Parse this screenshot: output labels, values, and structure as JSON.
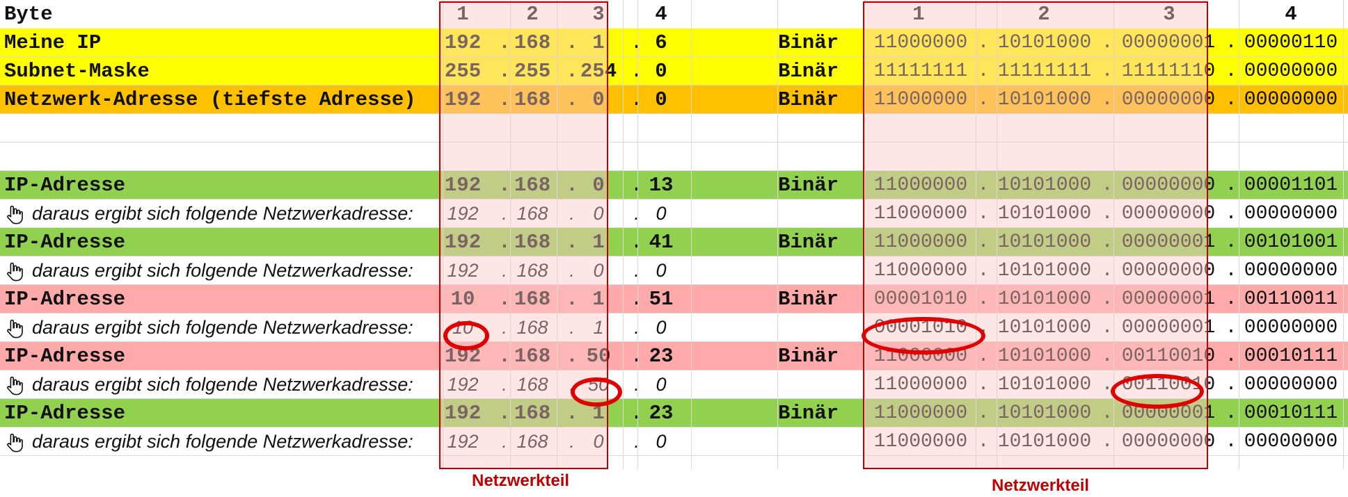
{
  "header": {
    "label": "Byte",
    "dec_cols": [
      "1",
      "2",
      "3",
      "4"
    ],
    "bin_cols": [
      "1",
      "2",
      "3",
      "4"
    ]
  },
  "rows": [
    {
      "label": "Meine IP",
      "style": "yellow",
      "kind": "main",
      "dec": [
        "192",
        "168",
        "1",
        "6"
      ],
      "bin_label": "Binär",
      "bin": [
        "11000000",
        "10101000",
        "00000001",
        "00000110"
      ]
    },
    {
      "label": "Subnet-Maske",
      "style": "yellow",
      "kind": "main",
      "dec": [
        "255",
        "255",
        "254",
        "0"
      ],
      "bin_label": "Binär",
      "bin": [
        "11111111",
        "11111111",
        "11111110",
        "00000000"
      ]
    },
    {
      "label": "Netzwerk-Adresse (tiefste Adresse)",
      "style": "orange",
      "kind": "main",
      "dec": [
        "192",
        "168",
        "0",
        "0"
      ],
      "bin_label": "Binär",
      "bin": [
        "11000000",
        "10101000",
        "00000000",
        "00000000"
      ]
    },
    {
      "label": "",
      "style": "empty",
      "kind": "empty",
      "dec": [
        "",
        "",
        "",
        ""
      ],
      "bin_label": "",
      "bin": [
        "",
        "",
        "",
        ""
      ]
    },
    {
      "label": "",
      "style": "empty",
      "kind": "empty",
      "dec": [
        "",
        "",
        "",
        ""
      ],
      "bin_label": "",
      "bin": [
        "",
        "",
        "",
        ""
      ]
    },
    {
      "label": "IP-Adresse",
      "style": "green",
      "kind": "main",
      "dec": [
        "192",
        "168",
        "0",
        "13"
      ],
      "bin_label": "Binär",
      "bin": [
        "11000000",
        "10101000",
        "00000000",
        "00001101"
      ]
    },
    {
      "label": "daraus ergibt sich folgende Netzwerkadresse:",
      "style": "white",
      "kind": "result",
      "dec": [
        "192",
        "168",
        "0",
        "0"
      ],
      "bin_label": "",
      "bin": [
        "11000000",
        "10101000",
        "00000000",
        "00000000"
      ]
    },
    {
      "label": "IP-Adresse",
      "style": "green",
      "kind": "main",
      "dec": [
        "192",
        "168",
        "1",
        "41"
      ],
      "bin_label": "Binär",
      "bin": [
        "11000000",
        "10101000",
        "00000001",
        "00101001"
      ]
    },
    {
      "label": "daraus ergibt sich folgende Netzwerkadresse:",
      "style": "white",
      "kind": "result",
      "dec": [
        "192",
        "168",
        "0",
        "0"
      ],
      "bin_label": "",
      "bin": [
        "11000000",
        "10101000",
        "00000000",
        "00000000"
      ]
    },
    {
      "label": "IP-Adresse",
      "style": "red",
      "kind": "main",
      "dec": [
        "10",
        "168",
        "1",
        "51"
      ],
      "bin_label": "Binär",
      "bin": [
        "00001010",
        "10101000",
        "00000001",
        "00110011"
      ]
    },
    {
      "label": "daraus ergibt sich folgende Netzwerkadresse:",
      "style": "white",
      "kind": "result",
      "dec": [
        "10",
        "168",
        "1",
        "0"
      ],
      "bin_label": "",
      "bin": [
        "00001010",
        "10101000",
        "00000001",
        "00000000"
      ]
    },
    {
      "label": "IP-Adresse",
      "style": "red",
      "kind": "main",
      "dec": [
        "192",
        "168",
        "50",
        "23"
      ],
      "bin_label": "Binär",
      "bin": [
        "11000000",
        "10101000",
        "00110010",
        "00010111"
      ]
    },
    {
      "label": "daraus ergibt sich folgende Netzwerkadresse:",
      "style": "white",
      "kind": "result",
      "dec": [
        "192",
        "168",
        "50",
        "0"
      ],
      "bin_label": "",
      "bin": [
        "11000000",
        "10101000",
        "00110010",
        "00000000"
      ]
    },
    {
      "label": "IP-Adresse",
      "style": "green",
      "kind": "main",
      "dec": [
        "192",
        "168",
        "1",
        "23"
      ],
      "bin_label": "Binär",
      "bin": [
        "11000000",
        "10101000",
        "00000001",
        "00010111"
      ]
    },
    {
      "label": "daraus ergibt sich folgende Netzwerkadresse:",
      "style": "white",
      "kind": "result",
      "dec": [
        "192",
        "168",
        "0",
        "0"
      ],
      "bin_label": "",
      "bin": [
        "11000000",
        "10101000",
        "00000000",
        "00000000"
      ]
    }
  ],
  "separator": ".",
  "captions": {
    "dec_part": "Netzwerkteil",
    "bin_part": "Netzwerkteil"
  },
  "colors": {
    "yellow": "#ffff00",
    "orange": "#ffc000",
    "green": "#92d050",
    "red": "#ffaaaa",
    "highlight": "#c00000",
    "circle": "#e00000"
  },
  "icons": {
    "result_marker": "pointing-hand-icon"
  }
}
